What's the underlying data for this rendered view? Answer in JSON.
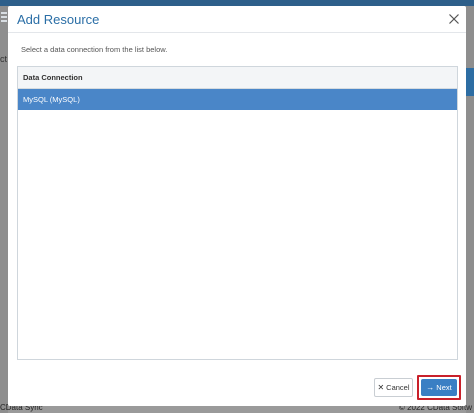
{
  "background": {
    "left_fragment": "ct",
    "footer_left": "CData Sync",
    "footer_right": "© 2022 CData Softw"
  },
  "modal": {
    "title": "Add Resource",
    "instruction": "Select a data connection from the list below.",
    "list": {
      "header": "Data Connection",
      "rows": [
        {
          "label": "MySQL (MySQL)",
          "selected": true
        }
      ]
    },
    "buttons": {
      "cancel_label": "Cancel",
      "next_label": "Next"
    }
  },
  "colors": {
    "title": "#2a6ea6",
    "selected_row": "#4a86c8",
    "primary_button": "#3a7fc4",
    "highlight_border": "#c9202a"
  }
}
